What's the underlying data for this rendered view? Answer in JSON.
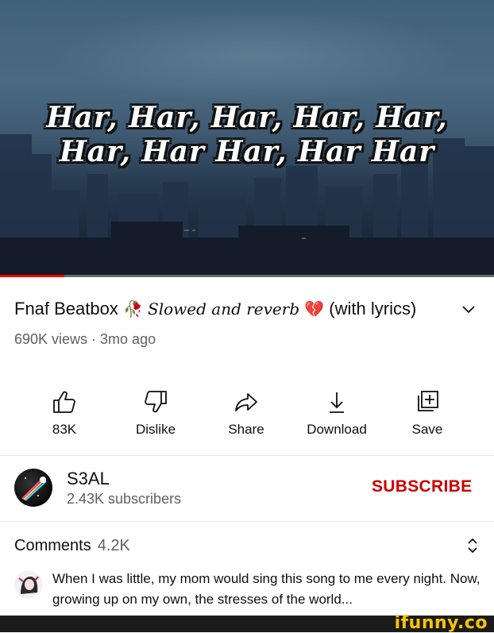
{
  "video": {
    "lyric_line_1": "Har, Har, Har, Har, Har,",
    "lyric_line_2": "Har, Har Har, Har Har",
    "progress": 0.13
  },
  "title": {
    "prefix": "Fnaf Beatbox ",
    "rose": "🥀",
    "script": "Slowed and reverb",
    "heart": "💔",
    "suffix": " (with lyrics)"
  },
  "meta": "690K views · 3mo ago",
  "actions": [
    {
      "label": "83K",
      "icon": "like-icon"
    },
    {
      "label": "Dislike",
      "icon": "dislike-icon"
    },
    {
      "label": "Share",
      "icon": "share-icon"
    },
    {
      "label": "Download",
      "icon": "download-icon"
    },
    {
      "label": "Save",
      "icon": "save-icon"
    }
  ],
  "channel": {
    "name": "S3AL",
    "subscribers": "2.43K subscribers",
    "subscribe_label": "SUBSCRIBE"
  },
  "comments": {
    "title": "Comments",
    "count": "4.2K",
    "first_comment": "When I was little, my mom would sing this song to me every night. Now, growing up on my own, the stresses of the world..."
  },
  "watermark": "ifunny.co",
  "colors": {
    "accent": "#cc0000",
    "progress": "#ff0000",
    "watermark": "#f7c600"
  }
}
